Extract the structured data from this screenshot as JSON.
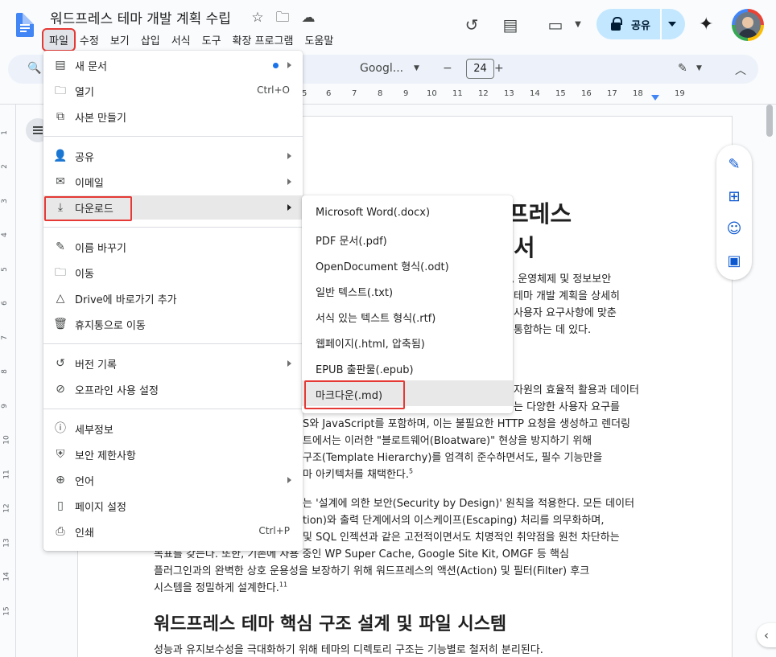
{
  "header": {
    "doc_title": "워드프레스 테마 개발 계획 수립",
    "share_label": "공유"
  },
  "menubar": [
    "파일",
    "수정",
    "보기",
    "삽입",
    "서식",
    "도구",
    "확장 프로그램",
    "도움말"
  ],
  "toolbar": {
    "font_name": "Googl...",
    "font_size": "24",
    "minus": "−",
    "plus": "+"
  },
  "ruler": {
    "numbers": [
      "5",
      "6",
      "7",
      "8",
      "9",
      "10",
      "11",
      "12",
      "13",
      "14",
      "15",
      "16",
      "17",
      "18",
      "19"
    ],
    "vnumbers": [
      "1",
      "2",
      "3",
      "4",
      "5",
      "6",
      "7",
      "8",
      "9",
      "10",
      "11",
      "12",
      "13",
      "14",
      "15"
    ]
  },
  "file_menu": {
    "new_doc": "새 문서",
    "open": "열기",
    "open_shortcut": "Ctrl+O",
    "copy": "사본 만들기",
    "share": "공유",
    "email": "이메일",
    "download": "다운로드",
    "rename": "이름 바꾸기",
    "move": "이동",
    "add_shortcut": "Drive에 바로가기 추가",
    "trash": "휴지통으로 이동",
    "version_history": "버전 기록",
    "offline": "오프라인 사용 설정",
    "details": "세부정보",
    "security": "보안 제한사항",
    "language": "언어",
    "page_setup": "페이지 설정",
    "print": "인쇄",
    "print_shortcut": "Ctrl+P"
  },
  "download_menu": [
    "Microsoft Word(.docx)",
    "PDF 문서(.pdf)",
    "OpenDocument 형식(.odt)",
    "일반 텍스트(.txt)",
    "서식 있는 텍스트 형식(.rtf)",
    "웹페이지(.html, 압축됨)",
    "EPUB 출판물(.epub)",
    "마크다운(.md)"
  ],
  "document": {
    "h1_line1": "프레스",
    "h1_line2": "서",
    "p1": [
      ", 운영체제 및 정보보안",
      " 테마 개발 계획을 상세히",
      "사용자 요구사항에 맞춘",
      "통합하는 데 있다."
    ],
    "p2": [
      "자원의 효율적 활용과 데이터",
      "는 다양한 사용자 요구를",
      "S와 JavaScript를 포함하며, 이는 불필요한 HTTP 요청을 생성하고 렌더링",
      "트에서는 이러한 \"블로트웨어(Bloatware)\" 현상을 방지하기 위해",
      " 구조(Template Hierarchy)를 엄격히 준수하면서도, 필수 기능만을",
      "마 아키텍처를 채택한다."
    ],
    "p2_sup": "5",
    "p3": [
      "는 '설계에 의한 보안(Security by Design)' 원칙을 적용한다. 모든 데이터",
      "tion)와 출력 단계에서의 이스케이프(Escaping) 처리를 의무화하며,",
      "및 SQL 인젝션과 같은 고전적이면서도 치명적인 취약점을 원천 차단하는",
      "목표를 갖는다. 또한, 기존에 사용 중인 WP Super Cache, Google Site Kit, OMGF 등 핵심",
      "플러그인과의 완벽한 상호 운용성을 보장하기 위해 워드프레스의 액션(Action) 및 필터(Filter) 후크",
      "시스템을 정밀하게 설계한다."
    ],
    "p3_sup": "11",
    "h2": "워드프레스 테마 핵심 구조 설계 및 파일 시스템",
    "p4": "성능과 유지보수성을 극대화하기 위해 테마의 디렉토리 구조는 기능별로 철저히 분리된다."
  }
}
